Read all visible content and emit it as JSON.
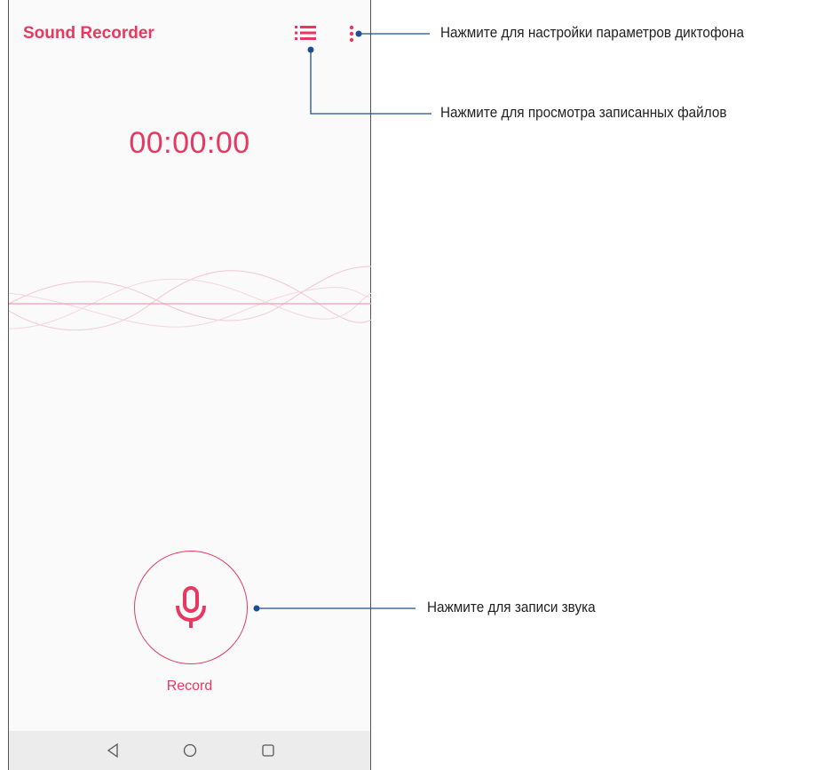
{
  "app": {
    "title": "Sound Recorder",
    "timer": "00:00:00",
    "record_label": "Record"
  },
  "toolbar": {
    "list_icon": "list-icon",
    "menu_icon": "more-vertical-icon"
  },
  "record_button": {
    "icon": "microphone-icon"
  },
  "navbar": {
    "back_icon": "back-triangle-icon",
    "home_icon": "home-circle-icon",
    "recents_icon": "recents-square-icon"
  },
  "callouts": {
    "settings": "Нажмите для настройки параметров диктофона",
    "files": "Нажмите для просмотра записанных файлов",
    "record": "Нажмите для записи звука"
  },
  "colors": {
    "accent": "#e8385f",
    "callout_line": "#1d4f91",
    "background": "#fafafa",
    "navbar": "#ececec"
  }
}
